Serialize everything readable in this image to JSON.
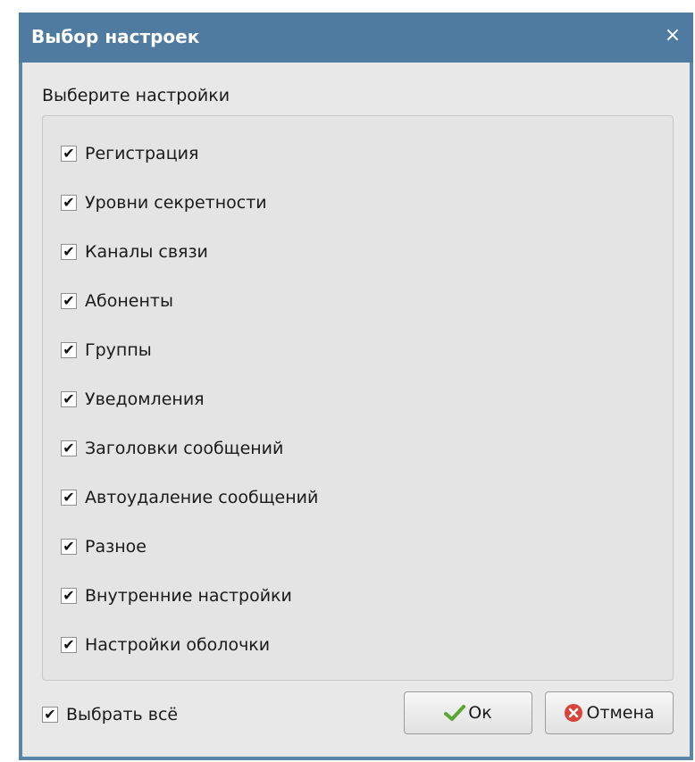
{
  "window": {
    "title": "Выбор настроек",
    "close_glyph": "×"
  },
  "group": {
    "label": "Выберите настройки",
    "items": [
      {
        "label": "Регистрация",
        "checked": true
      },
      {
        "label": "Уровни секретности",
        "checked": true
      },
      {
        "label": "Каналы связи",
        "checked": true
      },
      {
        "label": "Абоненты",
        "checked": true
      },
      {
        "label": "Группы",
        "checked": true
      },
      {
        "label": "Уведомления",
        "checked": true
      },
      {
        "label": "Заголовки сообщений",
        "checked": true
      },
      {
        "label": "Автоудаление сообщений",
        "checked": true
      },
      {
        "label": "Разное",
        "checked": true
      },
      {
        "label": "Внутренние настройки",
        "checked": true
      },
      {
        "label": "Настройки оболочки",
        "checked": true
      }
    ]
  },
  "footer": {
    "select_all": {
      "label": "Выбрать всё",
      "checked": true
    },
    "ok_button": {
      "label": "Ок",
      "icon": "checkmark-icon"
    },
    "cancel_button": {
      "label": "Отмена",
      "icon": "cancel-circle-icon"
    }
  },
  "check_glyph": "✔",
  "colors": {
    "titlebar": "#4f7ba1",
    "border": "#5a86a8",
    "background": "#e8e8e8",
    "ok_icon": "#5aa832",
    "cancel_icon": "#d9433a"
  }
}
